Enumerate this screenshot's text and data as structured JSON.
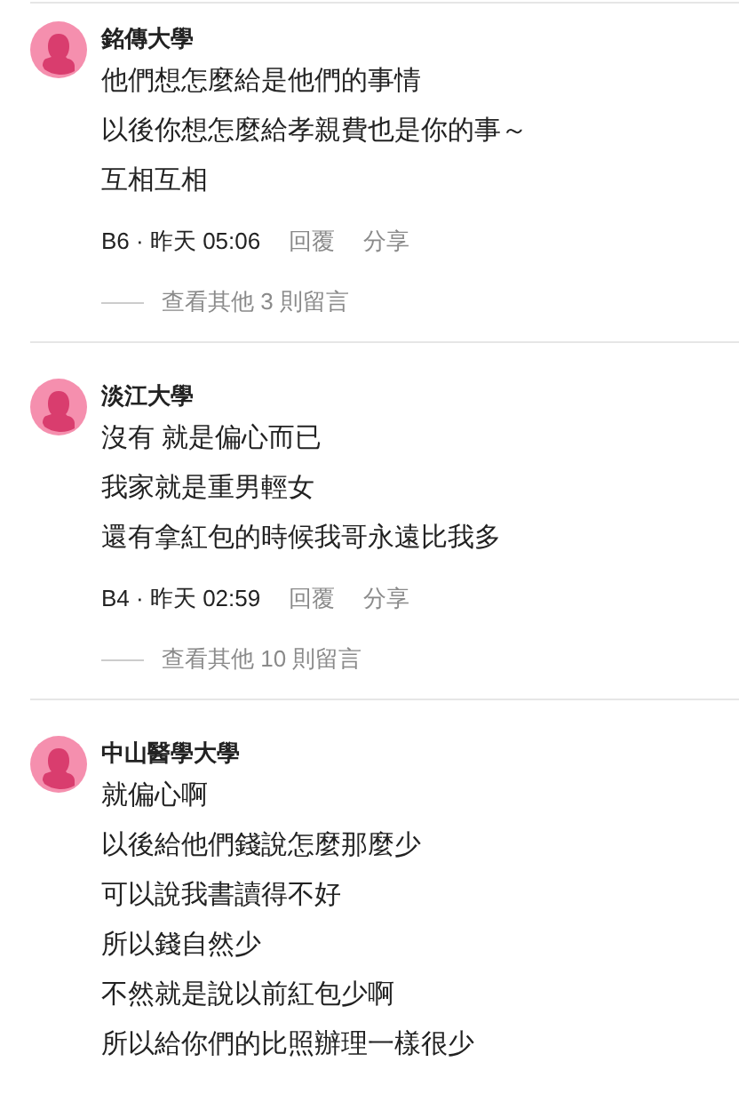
{
  "comments": [
    {
      "author": "銘傳大學",
      "lines": [
        "他們想怎麼給是他們的事情",
        "以後你想怎麼給孝親費也是你的事～",
        "互相互相"
      ],
      "meta": "B6 · 昨天 05:06",
      "actions": [
        "回覆",
        "分享"
      ],
      "more_replies": "查看其他 3 則留言"
    },
    {
      "author": "淡江大學",
      "lines": [
        "沒有 就是偏心而已",
        "我家就是重男輕女",
        "還有拿紅包的時候我哥永遠比我多"
      ],
      "meta": "B4 · 昨天 02:59",
      "actions": [
        "回覆",
        "分享"
      ],
      "more_replies": "查看其他 10 則留言"
    },
    {
      "author": "中山醫學大學",
      "lines": [
        "就偏心啊",
        "以後給他們錢說怎麼那麼少",
        "可以說我書讀得不好",
        "所以錢自然少",
        "不然就是說以前紅包少啊",
        "所以給你們的比照辦理一樣很少"
      ]
    }
  ]
}
